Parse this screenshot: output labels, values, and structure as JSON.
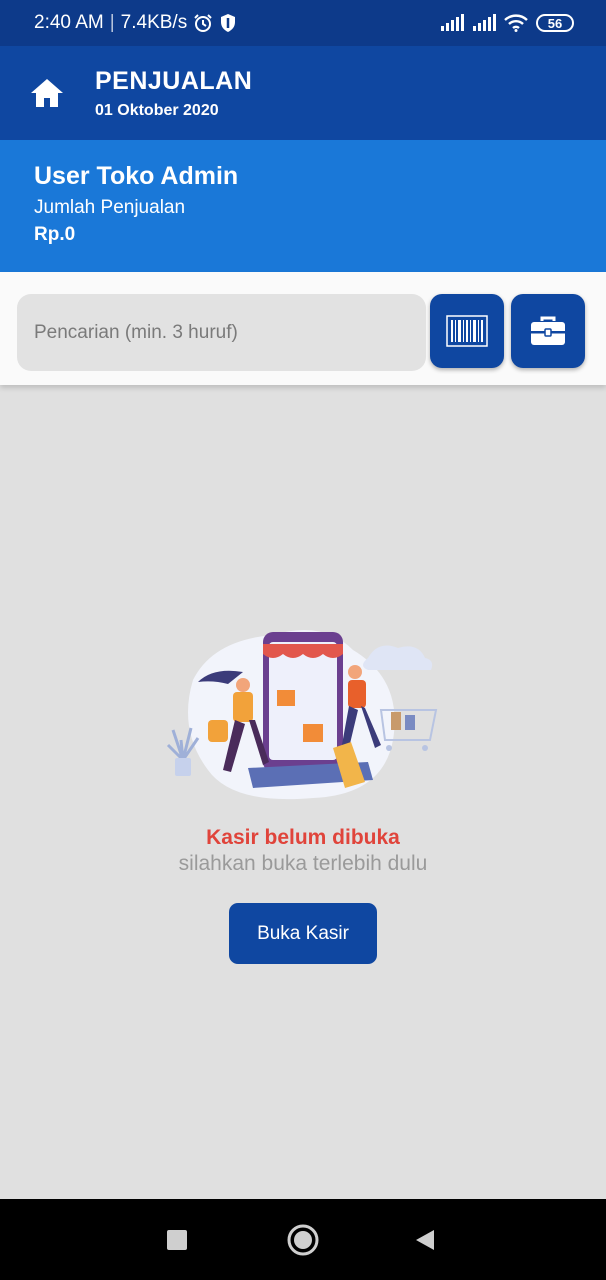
{
  "status_bar": {
    "time": "2:40 AM",
    "speed": "7.4KB/s",
    "battery": "56"
  },
  "app_bar": {
    "title": "PENJUALAN",
    "date": "01 Oktober 2020"
  },
  "user_panel": {
    "user_name": "User Toko Admin",
    "sales_label": "Jumlah Penjualan",
    "sales_amount": "Rp.0"
  },
  "search": {
    "placeholder": "Pencarian (min. 3 huruf)",
    "value": ""
  },
  "empty_state": {
    "title": "Kasir belum dibuka",
    "subtitle": "silahkan buka terlebih dulu",
    "button_label": "Buka Kasir"
  },
  "colors": {
    "primary": "#0f47a1",
    "secondary": "#1a78d8",
    "warning_text": "#e0443b"
  },
  "icons": {
    "home": "home-icon",
    "barcode": "barcode-icon",
    "cashier": "briefcase-icon",
    "nav_recent": "square-icon",
    "nav_home": "circle-icon",
    "nav_back": "triangle-back-icon"
  }
}
